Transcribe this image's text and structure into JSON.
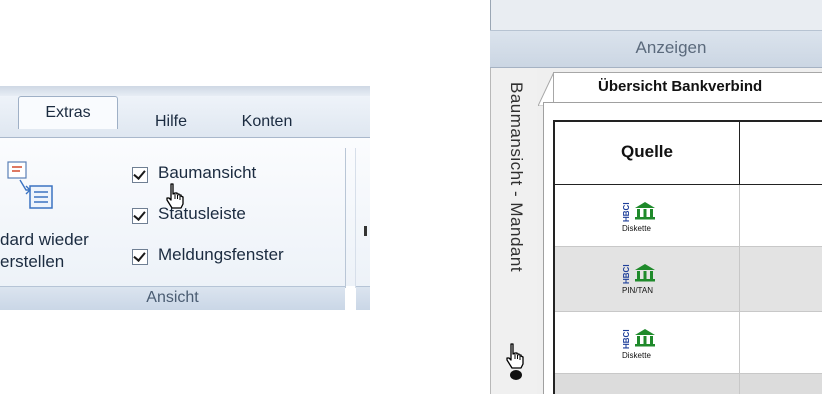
{
  "ribbon": {
    "tabs": [
      {
        "label": "Extras",
        "active": true
      },
      {
        "label": "Hilfe",
        "active": false
      },
      {
        "label": "Konten",
        "active": false
      }
    ],
    "standard_button": {
      "line1": "dard wieder",
      "line2": "erstellen"
    },
    "checkboxes": [
      {
        "label": "Baumansicht",
        "checked": true
      },
      {
        "label": "Statusleiste",
        "checked": true
      },
      {
        "label": "Meldungsfenster",
        "checked": true
      }
    ],
    "group_label": "Ansicht"
  },
  "right_panel": {
    "section_label": "Anzeigen",
    "vertical_tab": "Baumansicht - Mandant",
    "doc_tab": "Übersicht Bankverbind",
    "table": {
      "header": "Quelle",
      "rows": [
        {
          "badge": "HBCI",
          "sub": "Diskette"
        },
        {
          "badge": "HBCI",
          "sub": "PIN/TAN"
        },
        {
          "badge": "HBCI",
          "sub": "Diskette"
        }
      ]
    }
  },
  "colors": {
    "accent_green": "#1f8a2b",
    "hbci_blue": "#1e3f9a"
  }
}
